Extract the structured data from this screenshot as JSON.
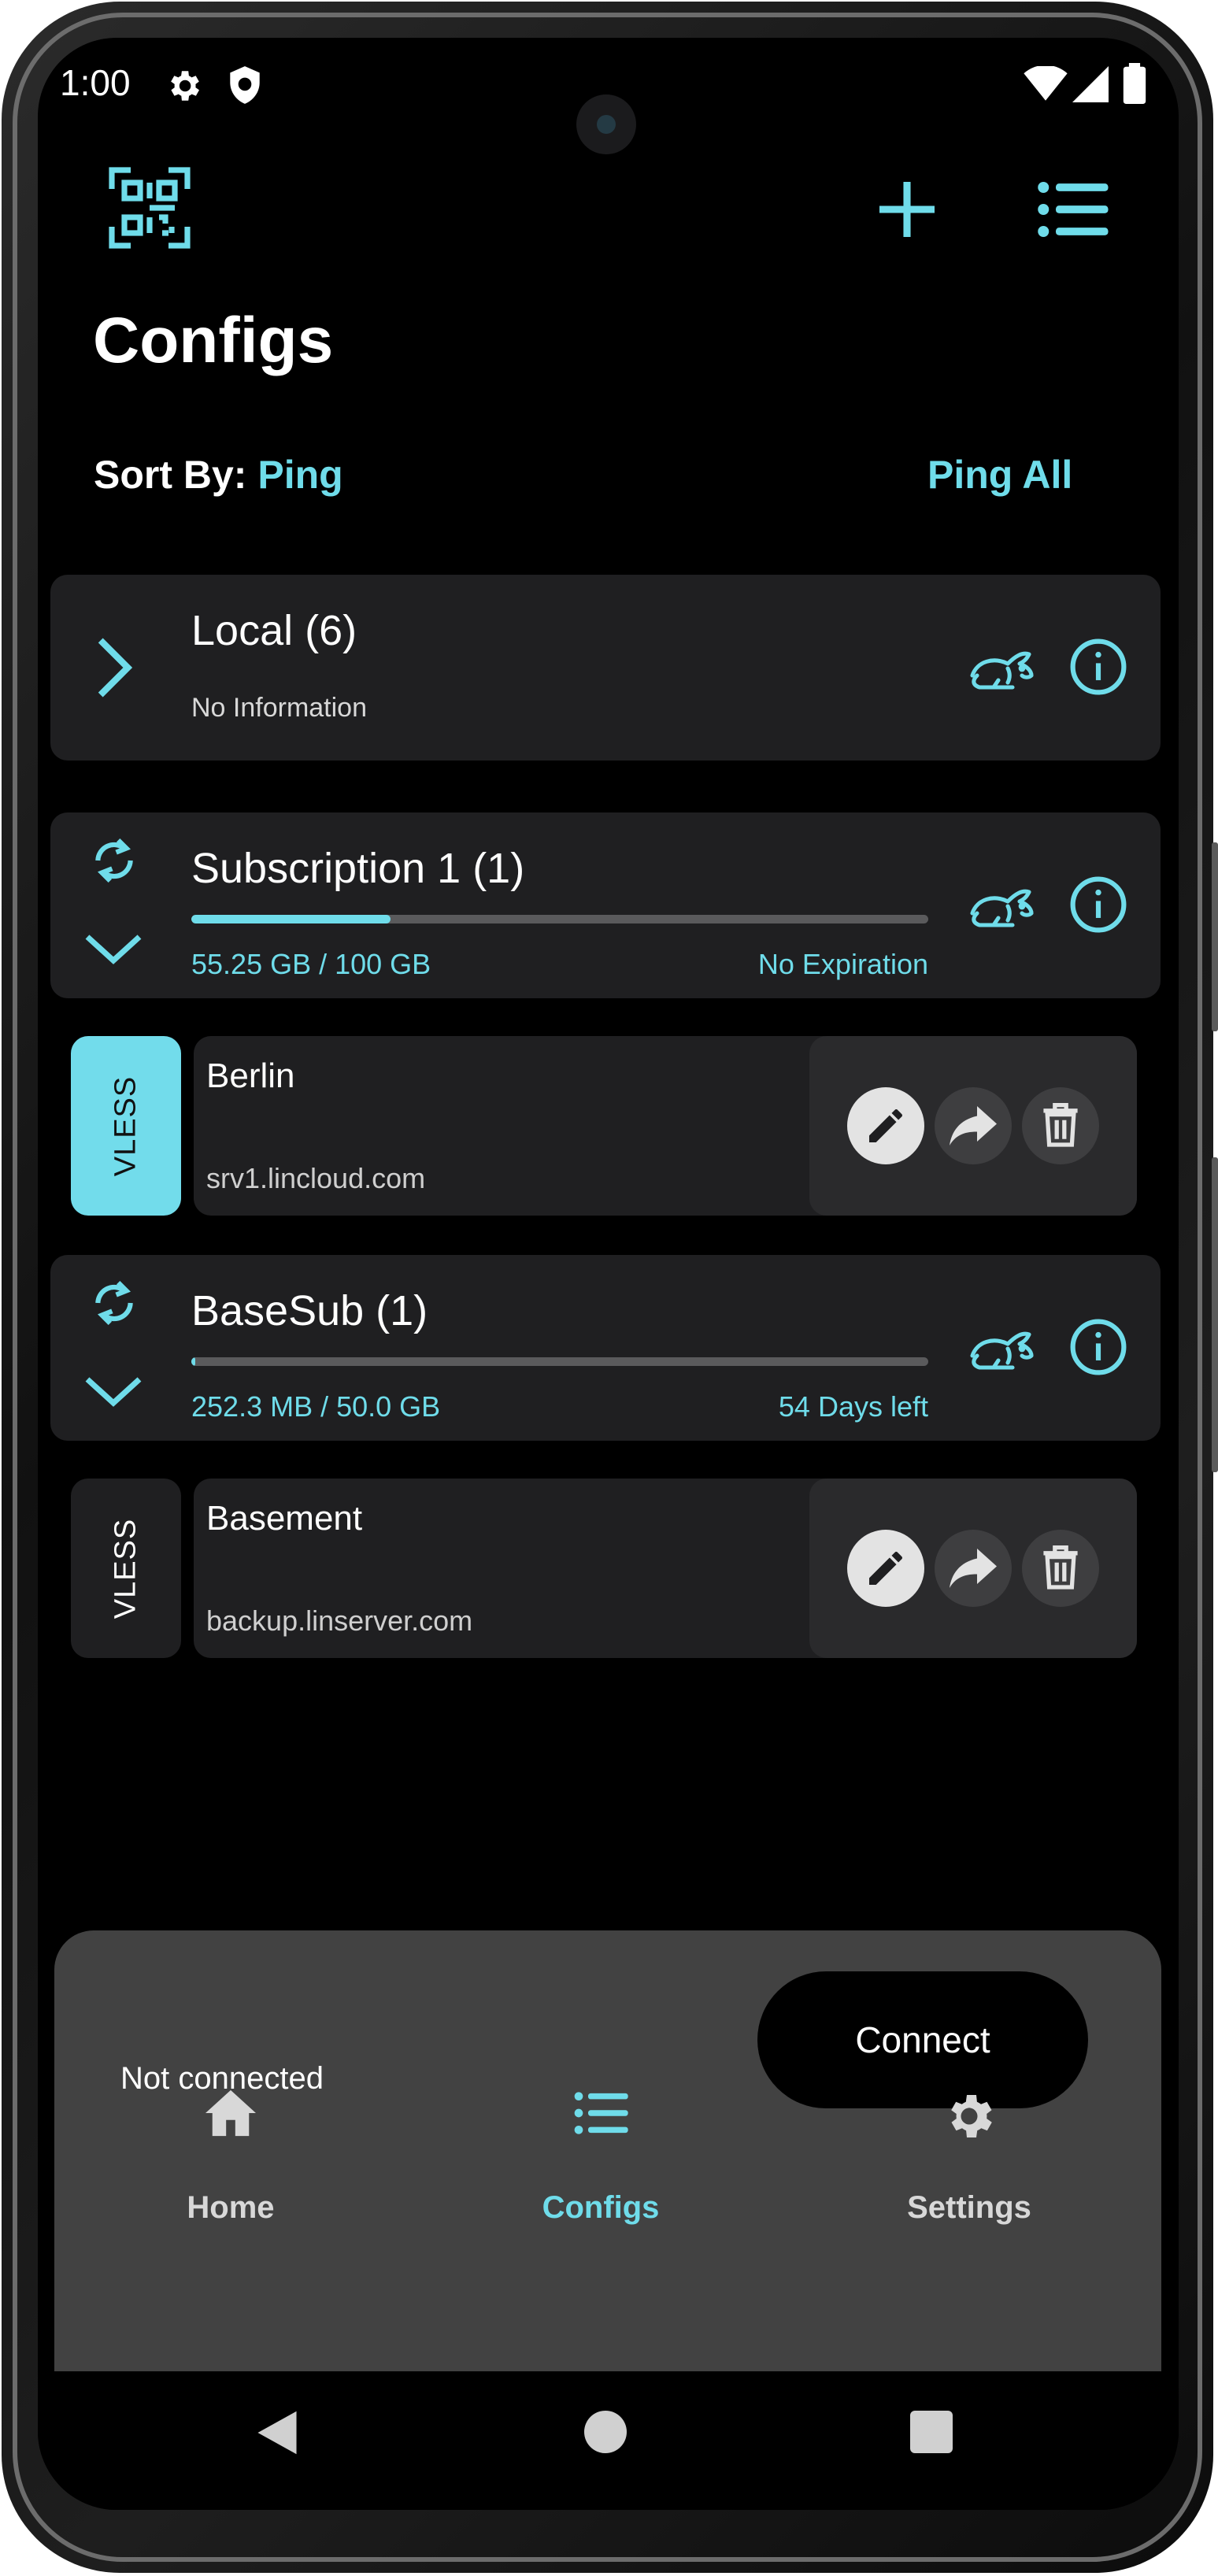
{
  "status_bar": {
    "time": "1:00"
  },
  "header": {
    "title": "Configs",
    "sort_label": "Sort By:",
    "sort_value": "Ping",
    "ping_all": "Ping All"
  },
  "groups": [
    {
      "name": "Local (6)",
      "info": "No Information"
    },
    {
      "name": "Subscription 1 (1)",
      "usage": "55.25 GB / 100 GB",
      "expiry": "No Expiration",
      "progress": 0.27
    },
    {
      "name": "BaseSub (1)",
      "usage": "252.3 MB / 50.0 GB",
      "expiry": "54 Days left",
      "progress": 0.005
    }
  ],
  "configs": [
    {
      "protocol": "VLESS",
      "name": "Berlin",
      "server": "srv1.lincloud.com",
      "selected": true
    },
    {
      "protocol": "VLESS",
      "name": "Basement",
      "server": "backup.linserver.com",
      "selected": false
    }
  ],
  "connection": {
    "status": "Not connected",
    "button": "Connect"
  },
  "bottom_nav": [
    {
      "label": "Home",
      "icon": "home-icon"
    },
    {
      "label": "Configs",
      "icon": "list-icon",
      "active": true
    },
    {
      "label": "Settings",
      "icon": "gear-icon"
    }
  ],
  "colors": {
    "accent": "#6fdcea",
    "card": "#1f1f21",
    "sheet": "#424242",
    "background": "#000000"
  }
}
